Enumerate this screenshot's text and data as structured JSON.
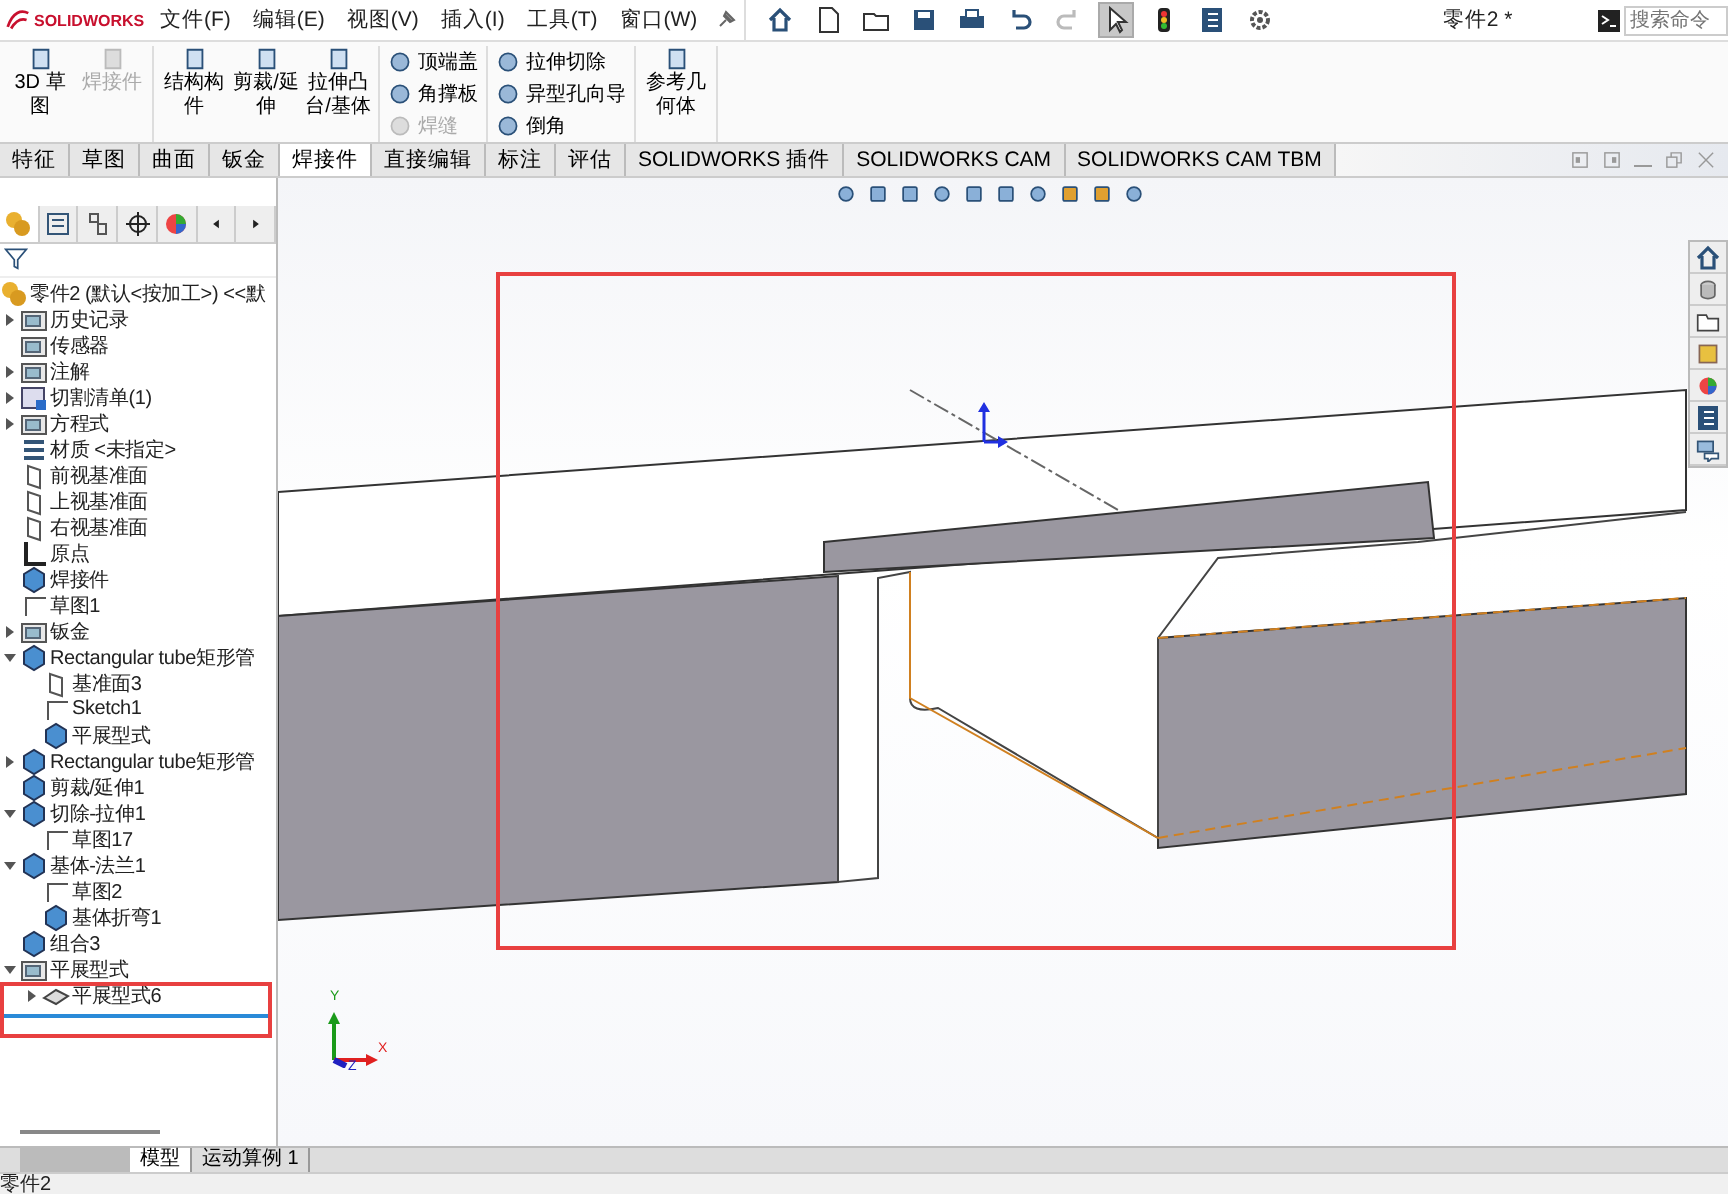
{
  "app": {
    "logo": "SOLIDWORKS",
    "menu": [
      "文件(F)",
      "编辑(E)",
      "视图(V)",
      "插入(I)",
      "工具(T)",
      "窗口(W)"
    ],
    "quick_tools": [
      {
        "kind": "home",
        "selected": false
      },
      {
        "kind": "new",
        "selected": false
      },
      {
        "kind": "open",
        "selected": false
      },
      {
        "kind": "save",
        "selected": false
      },
      {
        "kind": "print",
        "selected": false
      },
      {
        "kind": "undo",
        "selected": false
      },
      {
        "kind": "redo",
        "selected": false
      },
      {
        "kind": "select",
        "selected": true
      },
      {
        "kind": "rebuild",
        "selected": false
      },
      {
        "kind": "options",
        "selected": false
      },
      {
        "kind": "settings",
        "selected": false
      }
    ],
    "title": "零件2 *",
    "search": {
      "placeholder": "搜索命令"
    }
  },
  "ribbon": {
    "groups": [
      {
        "kind": "large",
        "buttons": [
          {
            "label": "3D 草图",
            "disabled": false
          },
          {
            "label": "焊接件",
            "disabled": true
          }
        ]
      },
      {
        "kind": "large",
        "buttons": [
          {
            "label": "结构构件",
            "disabled": false
          },
          {
            "label": "剪裁/延伸",
            "disabled": false
          },
          {
            "label": "拉伸凸台/基体",
            "disabled": false
          }
        ]
      },
      {
        "kind": "small",
        "buttons": [
          {
            "label": "顶端盖",
            "disabled": false
          },
          {
            "label": "角撑板",
            "disabled": false
          },
          {
            "label": "焊缝",
            "disabled": true
          }
        ]
      },
      {
        "kind": "small",
        "buttons": [
          {
            "label": "拉伸切除",
            "disabled": false
          },
          {
            "label": "异型孔向导",
            "disabled": false
          },
          {
            "label": "倒角",
            "disabled": false
          }
        ]
      },
      {
        "kind": "large",
        "buttons": [
          {
            "label": "参考几何体",
            "disabled": false
          }
        ]
      }
    ]
  },
  "tabs": [
    {
      "label": "特征",
      "selected": false
    },
    {
      "label": "草图",
      "selected": false
    },
    {
      "label": "曲面",
      "selected": false
    },
    {
      "label": "钣金",
      "selected": false
    },
    {
      "label": "焊接件",
      "selected": true
    },
    {
      "label": "直接编辑",
      "selected": false
    },
    {
      "label": "标注",
      "selected": false
    },
    {
      "label": "评估",
      "selected": false
    },
    {
      "label": "SOLIDWORKS 插件",
      "selected": false
    },
    {
      "label": "SOLIDWORKS CAM",
      "selected": false
    },
    {
      "label": "SOLIDWORKS CAM TBM",
      "selected": false
    }
  ],
  "tree": {
    "root": "零件2 (默认<按加工>) <<默",
    "items": [
      {
        "label": "历史记录",
        "kind": "folder",
        "expanded": false
      },
      {
        "label": "传感器",
        "kind": "folder"
      },
      {
        "label": "注解",
        "kind": "folder",
        "expanded": false
      },
      {
        "label": "切割清单(1)",
        "kind": "list",
        "expanded": false
      },
      {
        "label": "方程式",
        "kind": "folder",
        "expanded": false
      },
      {
        "label": "材质 <未指定>",
        "kind": "material"
      },
      {
        "label": "前视基准面",
        "kind": "plane"
      },
      {
        "label": "上视基准面",
        "kind": "plane"
      },
      {
        "label": "右视基准面",
        "kind": "plane"
      },
      {
        "label": "原点",
        "kind": "origin"
      },
      {
        "label": "焊接件",
        "kind": "feature"
      },
      {
        "label": "草图1",
        "kind": "sketch"
      },
      {
        "label": "钣金",
        "kind": "folder",
        "expanded": false
      },
      {
        "label": "Rectangular tube矩形管",
        "kind": "feature",
        "expanded": true,
        "children": [
          {
            "label": "基准面3",
            "kind": "plane"
          },
          {
            "label": "Sketch1",
            "kind": "sketch"
          },
          {
            "label": "平展型式",
            "kind": "feature"
          }
        ]
      },
      {
        "label": "Rectangular tube矩形管",
        "kind": "feature",
        "expanded": false
      },
      {
        "label": "剪裁/延伸1",
        "kind": "feature"
      },
      {
        "label": "切除-拉伸1",
        "kind": "feature",
        "expanded": true,
        "children": [
          {
            "label": "草图17",
            "kind": "sketch"
          }
        ]
      },
      {
        "label": "基体-法兰1",
        "kind": "feature",
        "expanded": true,
        "children": [
          {
            "label": "草图2",
            "kind": "sketch"
          },
          {
            "label": "基体折弯1",
            "kind": "feature"
          }
        ]
      },
      {
        "label": "组合3",
        "kind": "feature"
      },
      {
        "label": "平展型式",
        "kind": "folder",
        "expanded": true,
        "children": [
          {
            "label": "平展型式6",
            "kind": "flat",
            "expanded": false
          }
        ]
      }
    ]
  },
  "viewport": {
    "triad": [
      "Y",
      "X",
      "Z"
    ]
  },
  "bottom_tabs": [
    {
      "label": "模型",
      "selected": true
    },
    {
      "label": "运动算例 1",
      "selected": false
    }
  ],
  "status_bar": {
    "text": "零件2"
  }
}
